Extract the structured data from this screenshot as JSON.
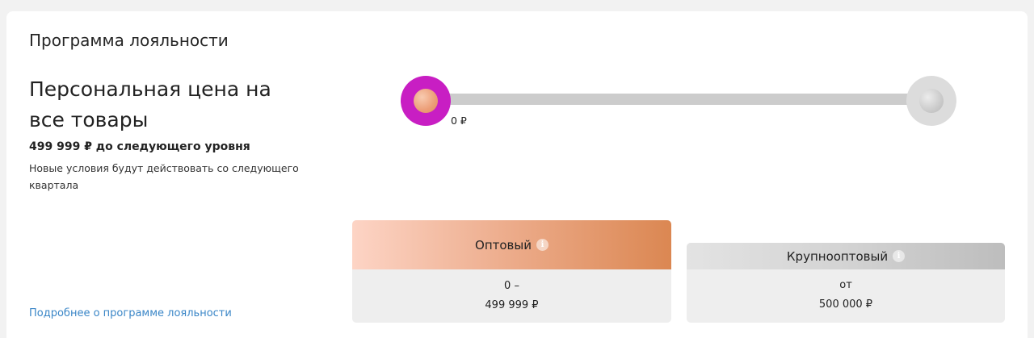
{
  "loyalty": {
    "section_title": "Программа лояльности",
    "level_title": "Персональная цена на все товары",
    "remaining": "499 999 ₽ до следующего уровня",
    "note": "Новые условия будут действовать со следующего квартала",
    "details_link": "Подробнее о программе лояльности"
  },
  "progress": {
    "value_label": "0 ₽",
    "fraction": 0.0,
    "current_color": "#c81ec3",
    "track_color": "#cccccc"
  },
  "tiers": [
    {
      "name": "Оптовый",
      "range_line1": "0 –",
      "range_line2": "499 999 ₽",
      "info_icon": "info-icon",
      "active": true
    },
    {
      "name": "Крупнооптовый",
      "range_line1": "от",
      "range_line2": "500 000 ₽",
      "info_icon": "info-icon",
      "active": false
    }
  ],
  "colors": {
    "link": "#3a86c7",
    "active_tier_gradient_start": "#fdd4c5",
    "active_tier_gradient_end": "#db8752",
    "inactive_tier_gradient_start": "#e3e3e3",
    "inactive_tier_gradient_end": "#bdbdbd"
  }
}
